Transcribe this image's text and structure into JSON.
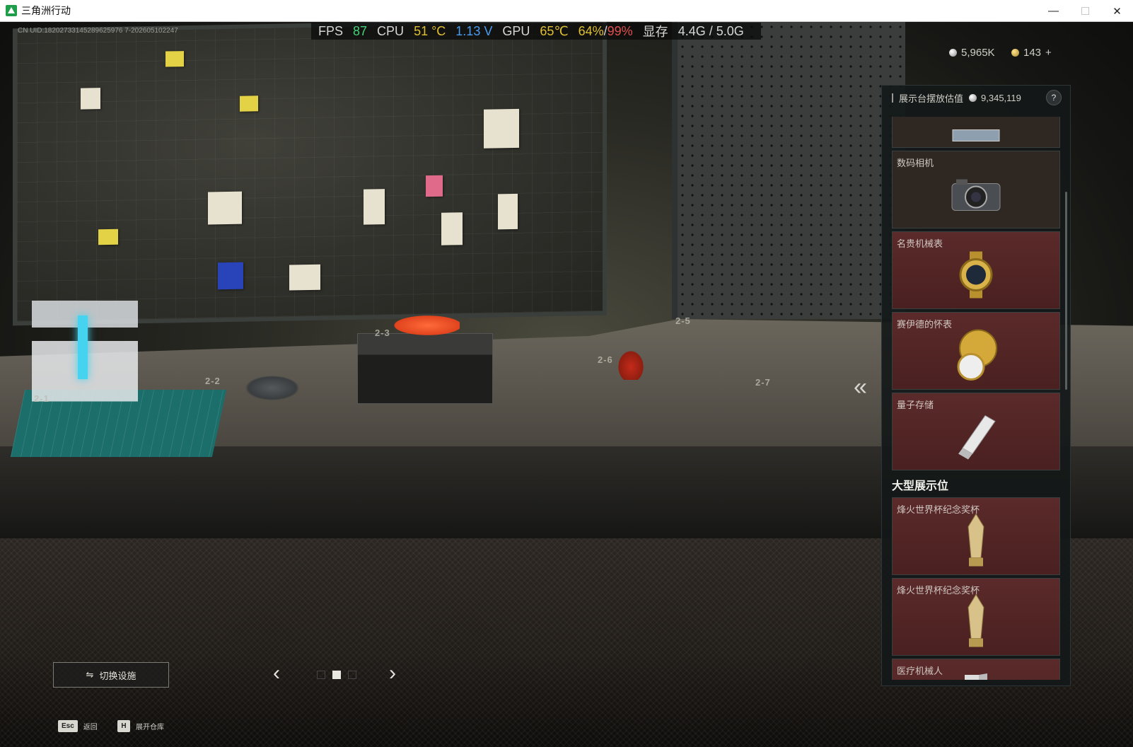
{
  "window": {
    "title": "三角洲行动",
    "controls": {
      "minimize": "—",
      "maximize": "☐",
      "close": "✕"
    }
  },
  "hud": {
    "uid": "CN UID:18202733145289625976 7-202605102247",
    "perf": {
      "fps_label": "FPS",
      "fps_value": "87",
      "cpu_label": "CPU",
      "cpu_temp": "51 °C",
      "cpu_volt": "1.13 V",
      "gpu_label": "GPU",
      "gpu_temp": "65℃",
      "gpu_load": "64%",
      "gpu_slash": "/",
      "gpu_mem_load": "99%",
      "vram_label": "显存",
      "vram_value": "4.4G / 5.0G"
    },
    "currency_silver": "5,965K",
    "currency_gold": "143",
    "currency_add": "+"
  },
  "scene": {
    "plinth_labels": [
      "2-1",
      "2-2",
      "2-3",
      "2-5",
      "2-6",
      "2-7"
    ]
  },
  "panel": {
    "header_label": "展示台摆放估值",
    "header_value": "9,345,119",
    "help": "?",
    "items": [
      {
        "label": "",
        "style": "brown",
        "icon": "laptop-icon"
      },
      {
        "label": "数码相机",
        "style": "brown",
        "icon": "camera-icon"
      },
      {
        "label": "名贵机械表",
        "style": "red",
        "icon": "watch-icon"
      },
      {
        "label": "赛伊德的怀表",
        "style": "red",
        "icon": "pocket-watch-icon"
      },
      {
        "label": "量子存储",
        "style": "red",
        "icon": "usb-drive-icon"
      }
    ],
    "large_section_title": "大型展示位",
    "large_items": [
      {
        "label": "烽火世界杯纪念奖杯",
        "style": "red",
        "icon": "trophy-icon"
      },
      {
        "label": "烽火世界杯纪念奖杯",
        "style": "red",
        "icon": "trophy-icon"
      },
      {
        "label": "医疗机械人",
        "style": "red",
        "icon": "robot-icon"
      }
    ]
  },
  "controls": {
    "switch_label": "切换设施",
    "prev": "‹",
    "next": "›",
    "collapse": "«",
    "hotkeys": [
      {
        "key": "Esc",
        "label": "返回"
      },
      {
        "key": "H",
        "label": "展开仓库"
      }
    ]
  }
}
